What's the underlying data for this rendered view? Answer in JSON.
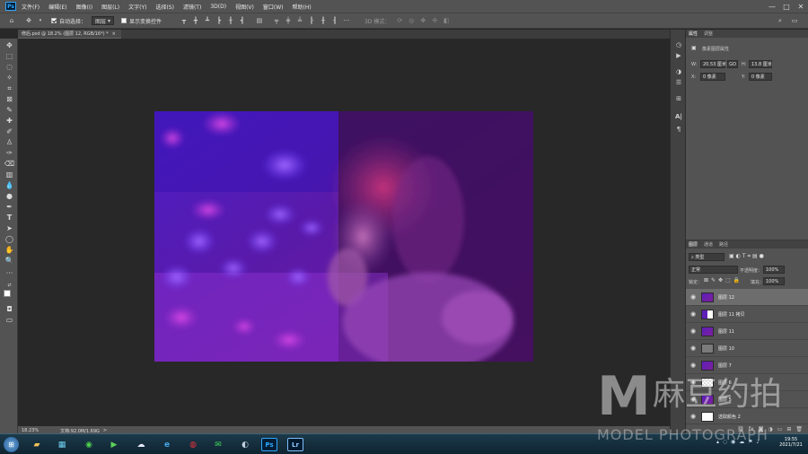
{
  "menubar": {
    "logo": "Ps",
    "items": [
      "文件(F)",
      "编辑(E)",
      "图像(I)",
      "图层(L)",
      "文字(Y)",
      "选择(S)",
      "滤镜(T)",
      "3D(D)",
      "视图(V)",
      "窗口(W)",
      "帮助(H)"
    ],
    "minimize": "—",
    "maximize": "□",
    "close": "✕"
  },
  "options": {
    "auto_select_label": "自动选择：",
    "auto_select_value": "图层",
    "show_transform_label": "显示变换控件",
    "mode_3d_label": "3D 模式：",
    "more": "···"
  },
  "document": {
    "tab_title": "修后.psd @ 18.2% (图层 12, RGB/16*) *",
    "tab_close": "×"
  },
  "status": {
    "zoom": "18.23%",
    "doc_size": "文档:92.0M/1.69G",
    "arrow": ">"
  },
  "properties_panel": {
    "tabs": [
      "属性",
      "调整"
    ],
    "section_title": "像素图层属性",
    "w_label": "W:",
    "w_value": "20.53 厘米",
    "link_icon_label": "GO",
    "h_label": "H:",
    "h_value": "13.8 厘米",
    "x_label": "X:",
    "x_value": "0 像素",
    "y_label": "Y:",
    "y_value": "0 像素"
  },
  "layers_panel": {
    "tabs": [
      "图层",
      "通道",
      "路径"
    ],
    "filter_kind": "类型",
    "blend_mode": "正常",
    "opacity_label": "不透明度：",
    "opacity_value": "100%",
    "lock_label": "锁定：",
    "fill_label": "填充：",
    "fill_value": "100%",
    "layers": [
      {
        "name": "图层 12",
        "selected": true,
        "thumb": "photo"
      },
      {
        "name": "图层 11 拷贝",
        "selected": false,
        "thumb": "mask"
      },
      {
        "name": "图层 11",
        "selected": false,
        "thumb": "photo"
      },
      {
        "name": "图层 10",
        "selected": false,
        "thumb": "gray"
      },
      {
        "name": "图层 7",
        "selected": false,
        "thumb": "photo"
      },
      {
        "name": "图层 6",
        "selected": false,
        "thumb": "checker"
      },
      {
        "name": "图层 5",
        "selected": false,
        "thumb": "photo"
      },
      {
        "name": "选取颜色 2",
        "selected": false,
        "thumb": "adjust"
      }
    ]
  },
  "taskbar": {
    "apps": [
      "start",
      "explorer",
      "media-center",
      "360-browser",
      "media-player",
      "baidu-netdisk",
      "ie",
      "netease-music",
      "wechat",
      "c4d",
      "photoshop",
      "lightroom"
    ],
    "ps_label": "Ps",
    "lr_label": "Lr",
    "time": "19:55",
    "date": "2021/7/21"
  },
  "watermark": {
    "letter": "M",
    "cn": "麻豆约拍",
    "en": "MODEL PHOTOGRAPH"
  },
  "colors": {
    "ui_gray": "#535353",
    "canvas_bg": "#282828",
    "ps_blue": "#31a8ff"
  }
}
